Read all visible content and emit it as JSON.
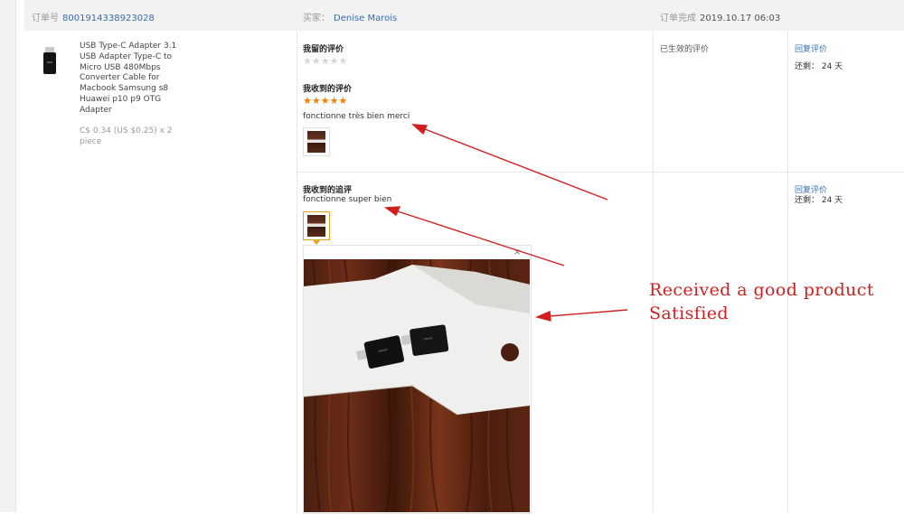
{
  "header": {
    "order_label": "订单号",
    "order_number": "8001914338923028",
    "buyer_label": "买家：",
    "buyer_name": "Denise Marois",
    "completed_label": "订单完成",
    "completed_time": "2019.10.17 06:03"
  },
  "product": {
    "title": "USB Type-C Adapter 3.1 USB Adapter Type-C to Micro USB 480Mbps Converter Cable for Macbook Samsung s8 Huawei p10 p9 OTG Adapter",
    "price": "C$ 0.34 (US $0.25) x 2 piece"
  },
  "my_review": {
    "label": "我留的评价",
    "stars_filled": 0,
    "stars_total": 5
  },
  "received_review": {
    "label": "我收到的评价",
    "stars_filled": 5,
    "stars_total": 5,
    "text": "fonctionne très bien merci"
  },
  "followup_review": {
    "label": "我收到的追评",
    "text": "fonctionne super bien"
  },
  "status": {
    "effective_review": "已生效的评价"
  },
  "actions": {
    "reply_label_1": "回复评价",
    "remain_1": "还剩： 24 天",
    "reply_label_2": "回复评价",
    "remain_2": "还剩： 24 天"
  },
  "preview": {
    "close_glyph": "×"
  },
  "annotation": {
    "line1": "Received a good product",
    "line2": "Satisfied",
    "color": "#d21e1e"
  },
  "colors": {
    "link": "#3a6ea8",
    "star_active": "#f08200",
    "star_inactive": "#d6d6d6",
    "header_bg": "#f2f2f2"
  }
}
